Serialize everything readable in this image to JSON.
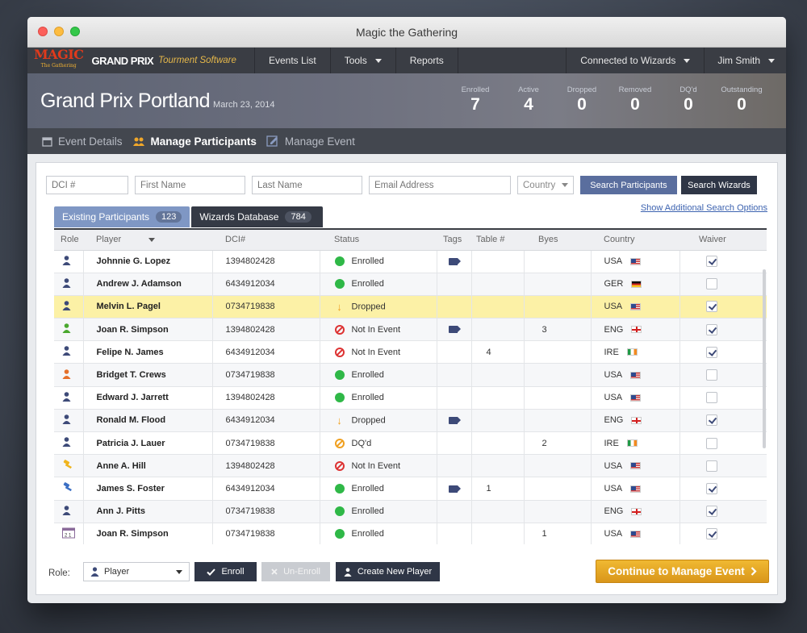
{
  "window": {
    "title": "Magic the Gathering"
  },
  "navbar": {
    "logo_text": "MAGIC",
    "logo_sub": "The Gathering",
    "grandprix": "GRAND PRIX",
    "software": "Tourment Software",
    "items": [
      {
        "label": "Events List"
      },
      {
        "label": "Tools"
      },
      {
        "label": "Reports"
      }
    ],
    "connection": "Connected to Wizards",
    "user": "Jim Smith"
  },
  "event": {
    "name": "Grand Prix Portland",
    "date": "March 23, 2014",
    "stats": [
      {
        "label": "Enrolled",
        "value": "7"
      },
      {
        "label": "Active",
        "value": "4"
      },
      {
        "label": "Dropped",
        "value": "0"
      },
      {
        "label": "Removed",
        "value": "0"
      },
      {
        "label": "DQ'd",
        "value": "0"
      },
      {
        "label": "Outstanding",
        "value": "0"
      }
    ]
  },
  "main_tabs": [
    {
      "label": "Event Details",
      "icon": "calendar-icon"
    },
    {
      "label": "Manage Participants",
      "icon": "people-icon"
    },
    {
      "label": "Manage Event",
      "icon": "edit-event-icon"
    }
  ],
  "search": {
    "dci_placeholder": "DCI #",
    "first_placeholder": "First Name",
    "last_placeholder": "Last Name",
    "email_placeholder": "Email Address",
    "country_value": "Country",
    "search_participants": "Search Participants",
    "search_wizards": "Search Wizards",
    "advanced_link": "Show Additional Search Options"
  },
  "data_tabs": [
    {
      "label": "Existing Participants",
      "count": "123"
    },
    {
      "label": "Wizards Database",
      "count": "784"
    }
  ],
  "table": {
    "columns": [
      "Role",
      "Player",
      "DCI#",
      "Status",
      "Tags",
      "Table #",
      "Byes",
      "Country",
      "Waiver"
    ],
    "rows": [
      {
        "role": "player",
        "name": "Johnnie G. Lopez",
        "dci": "1394802428",
        "status": "Enrolled",
        "tag": true,
        "table": "",
        "byes": "",
        "country": "USA",
        "waiver": true
      },
      {
        "role": "player",
        "name": "Andrew J. Adamson",
        "dci": "6434912034",
        "status": "Enrolled",
        "tag": false,
        "table": "",
        "byes": "",
        "country": "GER",
        "waiver": false
      },
      {
        "role": "player",
        "name": "Melvin L. Pagel",
        "dci": "0734719838",
        "status": "Dropped",
        "tag": false,
        "table": "",
        "byes": "",
        "country": "USA",
        "waiver": true,
        "highlight": true
      },
      {
        "role": "green",
        "name": "Joan R. Simpson",
        "dci": "1394802428",
        "status": "Not In Event",
        "tag": true,
        "table": "",
        "byes": "3",
        "country": "ENG",
        "waiver": true
      },
      {
        "role": "player",
        "name": "Felipe N. James",
        "dci": "6434912034",
        "status": "Not In Event",
        "tag": false,
        "table": "4",
        "byes": "",
        "country": "IRE",
        "waiver": true
      },
      {
        "role": "orange",
        "name": "Bridget T. Crews",
        "dci": "0734719838",
        "status": "Enrolled",
        "tag": false,
        "table": "",
        "byes": "",
        "country": "USA",
        "waiver": false
      },
      {
        "role": "player",
        "name": "Edward J. Jarrett",
        "dci": "1394802428",
        "status": "Enrolled",
        "tag": false,
        "table": "",
        "byes": "",
        "country": "USA",
        "waiver": false
      },
      {
        "role": "player",
        "name": "Ronald M. Flood",
        "dci": "6434912034",
        "status": "Dropped",
        "tag": true,
        "table": "",
        "byes": "",
        "country": "ENG",
        "waiver": true
      },
      {
        "role": "player",
        "name": "Patricia J. Lauer",
        "dci": "0734719838",
        "status": "DQ'd",
        "tag": false,
        "table": "",
        "byes": "2",
        "country": "IRE",
        "waiver": false
      },
      {
        "role": "judge-yellow",
        "name": "Anne A. Hill",
        "dci": "1394802428",
        "status": "Not In Event",
        "tag": false,
        "table": "",
        "byes": "",
        "country": "USA",
        "waiver": false
      },
      {
        "role": "judge-blue",
        "name": "James S. Foster",
        "dci": "6434912034",
        "status": "Enrolled",
        "tag": true,
        "table": "1",
        "byes": "",
        "country": "USA",
        "waiver": true
      },
      {
        "role": "player",
        "name": "Ann J. Pitts",
        "dci": "0734719838",
        "status": "Enrolled",
        "tag": false,
        "table": "",
        "byes": "",
        "country": "ENG",
        "waiver": true
      },
      {
        "role": "calendar",
        "name": "Joan R. Simpson",
        "dci": "0734719838",
        "status": "Enrolled",
        "tag": false,
        "table": "",
        "byes": "1",
        "country": "USA",
        "waiver": true
      },
      {
        "role": "player",
        "name": "",
        "dci": "",
        "status": "",
        "tag": false,
        "table": "",
        "byes": "",
        "country": "",
        "waiver": false
      }
    ]
  },
  "footer": {
    "role_label": "Role:",
    "role_value": "Player",
    "enroll": "Enroll",
    "unenroll": "Un-Enroll",
    "create": "Create New Player",
    "continue": "Continue to Manage Event"
  },
  "colors": {
    "accent_blue": "#5a6e9e",
    "dark": "#2f3646",
    "continue_gold": "#e3a624",
    "highlight_row": "#fcf1a6",
    "enrolled_green": "#2fb847",
    "not_in_event_red": "#dd3333"
  }
}
